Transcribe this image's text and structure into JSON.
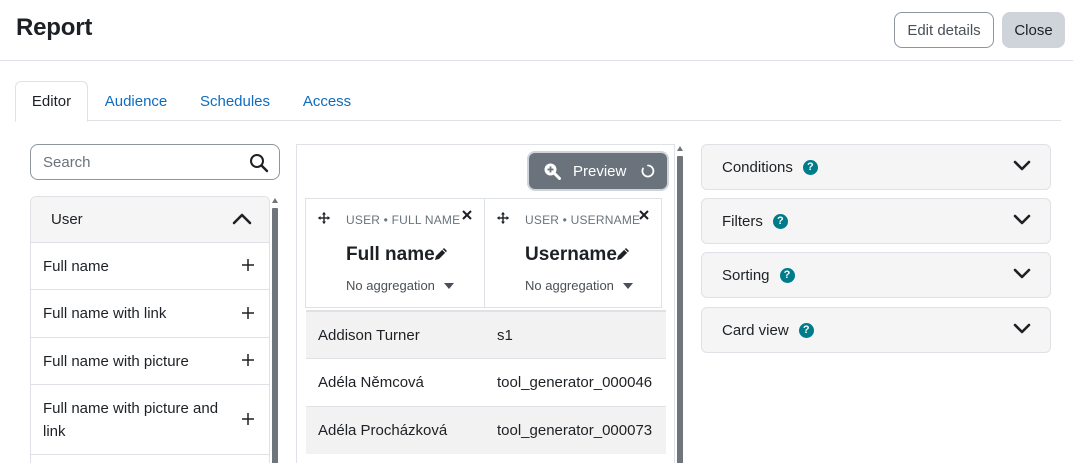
{
  "header": {
    "title": "Report",
    "edit_details_label": "Edit details",
    "close_label": "Close"
  },
  "tabs": [
    {
      "label": "Editor",
      "active": true
    },
    {
      "label": "Audience",
      "active": false
    },
    {
      "label": "Schedules",
      "active": false
    },
    {
      "label": "Access",
      "active": false
    }
  ],
  "sidebar": {
    "search": {
      "placeholder": "Search",
      "value": ""
    },
    "group_title": "User",
    "items": [
      {
        "label": "Full name"
      },
      {
        "label": "Full name with link"
      },
      {
        "label": "Full name with picture"
      },
      {
        "label": "Full name with picture and link"
      }
    ]
  },
  "preview": {
    "label": "Preview"
  },
  "table": {
    "columns": [
      {
        "kicker": "USER • FULL NAME",
        "title": "Full name",
        "aggregation": "No aggregation"
      },
      {
        "kicker": "USER • USERNAME",
        "title": "Username",
        "aggregation": "No aggregation"
      }
    ],
    "rows": [
      {
        "full_name": "Addison Turner",
        "username": "s1"
      },
      {
        "full_name": "Adéla Němcová",
        "username": "tool_generator_000046"
      },
      {
        "full_name": "Adéla Procházková",
        "username": "tool_generator_000073"
      }
    ]
  },
  "settings": {
    "sections": [
      {
        "label": "Conditions"
      },
      {
        "label": "Filters"
      },
      {
        "label": "Sorting"
      },
      {
        "label": "Card view"
      }
    ],
    "help_glyph": "?"
  },
  "colors": {
    "link": "#0f6cbf",
    "help_badge": "#007b8a",
    "preview_bg": "#6a737b"
  }
}
